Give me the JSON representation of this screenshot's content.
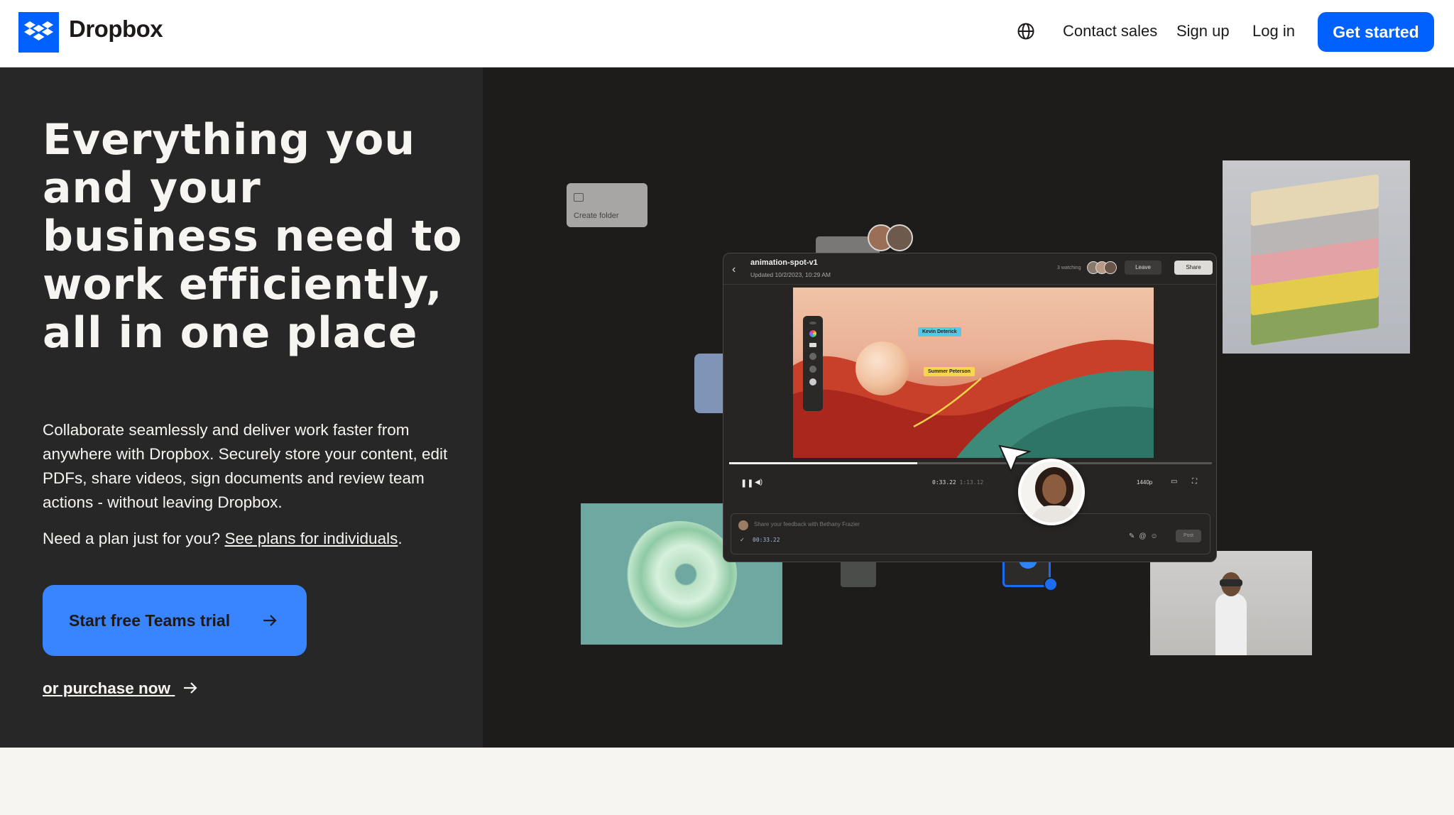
{
  "header": {
    "brand": "Dropbox",
    "nav": {
      "contact_sales": "Contact sales",
      "sign_up": "Sign up",
      "log_in": "Log in",
      "get_started": "Get started"
    },
    "icons": {
      "logo": "dropbox-logo-icon",
      "language": "globe-icon"
    },
    "colors": {
      "brand_blue": "#0061fe"
    }
  },
  "hero": {
    "title": "Everything you and your business need to work efficiently, all in one place",
    "description": "Collaborate seamlessly and deliver work faster from anywhere with Dropbox. Securely store your content, edit PDFs, share videos, sign documents and review team actions - without leaving Dropbox.",
    "plan_prefix": "Need a plan just for you?",
    "plan_link": "See plans for individuals",
    "plan_suffix": ".",
    "cta_primary": "Start free Teams trial",
    "cta_secondary": "or purchase now",
    "colors": {
      "panel_bg": "#282727",
      "cta_bg": "#3984ff"
    }
  },
  "showcase": {
    "create_folder_label": "Create folder",
    "player": {
      "file_name": "animation-spot-v1",
      "updated": "Updated 10/2/2023, 10:29 AM",
      "watching": "3 watching",
      "leave_label": "Leave",
      "share_label": "Share",
      "tag_kevin": "Kevin Deterick",
      "tag_summer": "Summer Peterson",
      "time_current": "0:33.22",
      "time_total": "1:13.12",
      "quality": "1440p",
      "comment_placeholder": "Share your feedback with Bethany Frazier",
      "comment_timestamp": "00:33.22",
      "post_label": "Post",
      "progress": 0.39
    }
  }
}
